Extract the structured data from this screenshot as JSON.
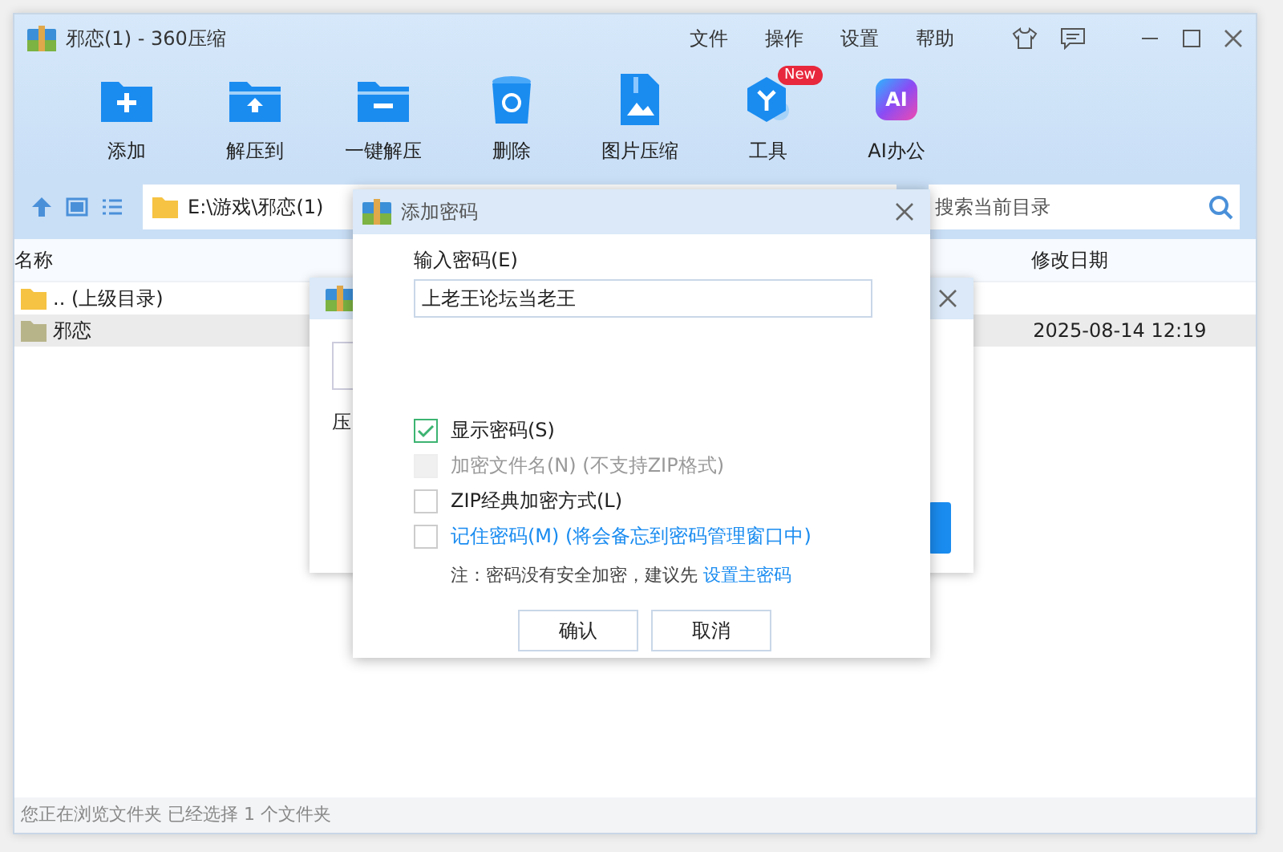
{
  "window": {
    "title": "邪恋(1) - 360压缩",
    "menu": [
      "文件",
      "操作",
      "设置",
      "帮助"
    ]
  },
  "toolbar": [
    {
      "label": "添加",
      "kind": "add"
    },
    {
      "label": "解压到",
      "kind": "extract"
    },
    {
      "label": "一键解压",
      "kind": "oneclick"
    },
    {
      "label": "删除",
      "kind": "delete"
    },
    {
      "label": "图片压缩",
      "kind": "image"
    },
    {
      "label": "工具",
      "kind": "tools",
      "badge": "New"
    },
    {
      "label": "AI办公",
      "kind": "ai",
      "icon_text": "AI"
    }
  ],
  "address": {
    "path": "E:\\游戏\\邪恋(1)",
    "search_placeholder": "搜索当前目录"
  },
  "file_list": {
    "columns": [
      "名称",
      "修改日期"
    ],
    "rows": [
      {
        "name": ".. (上级目录)",
        "date": "",
        "kind": "parent",
        "selected": false
      },
      {
        "name": "邪恋",
        "date": "2025-08-14 12:19",
        "kind": "folder",
        "selected": true
      }
    ]
  },
  "status_bar": "您正在浏览文件夹 已经选择 1 个文件夹",
  "back_dialog": {
    "label": "压"
  },
  "dialog": {
    "title": "添加密码",
    "password_label": "输入密码(E)",
    "password": "上老王论坛当老王",
    "options": [
      {
        "label": "显示密码(S)",
        "checked": true,
        "disabled": false,
        "kind": "plain"
      },
      {
        "label": "加密文件名(N) (不支持ZIP格式)",
        "checked": false,
        "disabled": true,
        "kind": "plain"
      },
      {
        "label": "ZIP经典加密方式(L)",
        "checked": false,
        "disabled": false,
        "kind": "plain"
      },
      {
        "label": "记住密码(M) (将会备忘到密码管理窗口中)",
        "checked": false,
        "disabled": false,
        "kind": "link"
      }
    ],
    "note": "注：密码没有安全加密，建议先",
    "note_link": "设置主密码",
    "buttons": [
      "确认",
      "取消"
    ]
  }
}
